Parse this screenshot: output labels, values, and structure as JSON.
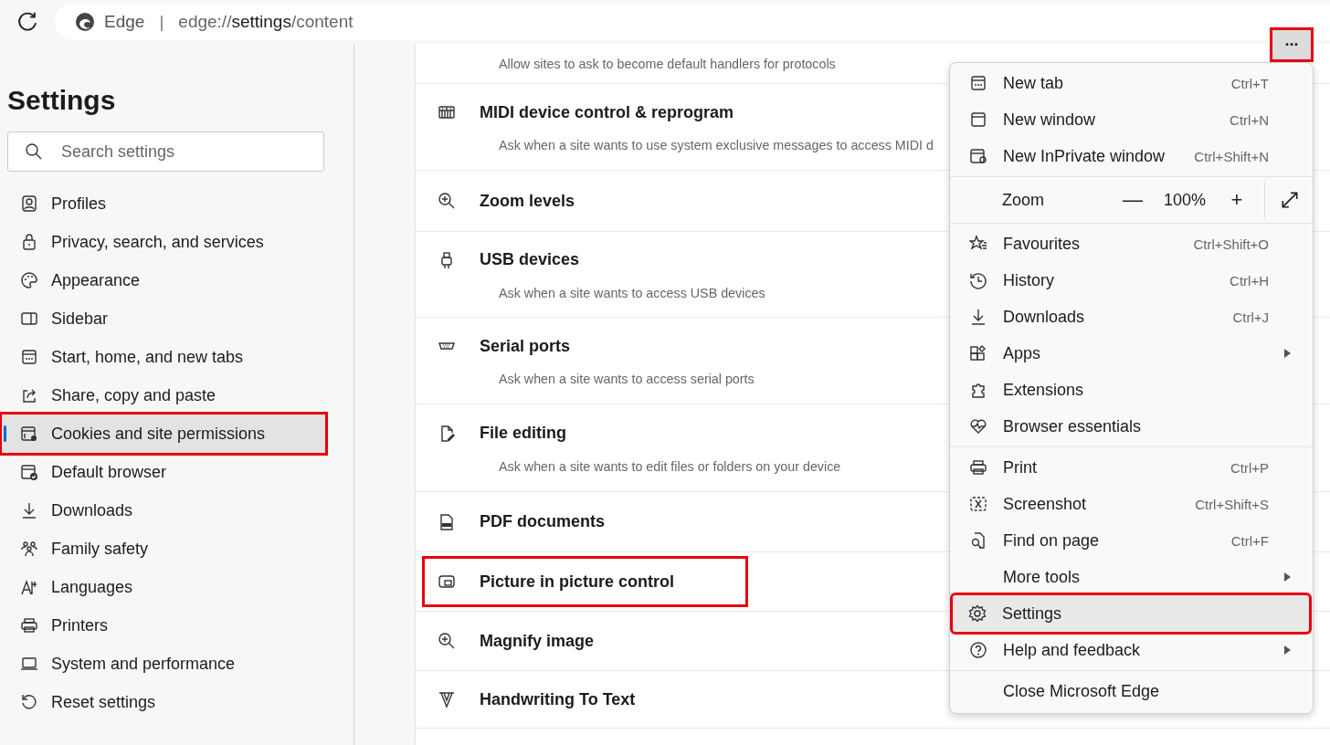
{
  "address_bar": {
    "browser_label": "Edge",
    "separator": "|",
    "url": "edge://**settings**/content"
  },
  "sidebar": {
    "title": "Settings",
    "search": {
      "placeholder": "Search settings"
    },
    "items": [
      {
        "label": "Profiles",
        "selected": false,
        "highlighted": false
      },
      {
        "label": "Privacy, search, and services",
        "selected": false,
        "highlighted": false
      },
      {
        "label": "Appearance",
        "selected": false,
        "highlighted": false
      },
      {
        "label": "Sidebar",
        "selected": false,
        "highlighted": false
      },
      {
        "label": "Start, home, and new tabs",
        "selected": false,
        "highlighted": false
      },
      {
        "label": "Share, copy and paste",
        "selected": false,
        "highlighted": false
      },
      {
        "label": "Cookies and site permissions",
        "selected": true,
        "highlighted": true
      },
      {
        "label": "Default browser",
        "selected": false,
        "highlighted": false
      },
      {
        "label": "Downloads",
        "selected": false,
        "highlighted": false
      },
      {
        "label": "Family safety",
        "selected": false,
        "highlighted": false
      },
      {
        "label": "Languages",
        "selected": false,
        "highlighted": false
      },
      {
        "label": "Printers",
        "selected": false,
        "highlighted": false
      },
      {
        "label": "System and performance",
        "selected": false,
        "highlighted": false
      },
      {
        "label": "Reset settings",
        "selected": false,
        "highlighted": false
      }
    ]
  },
  "permissions": [
    {
      "description": "Allow sites to ask to become default handlers for protocols",
      "highlighted": false
    },
    {
      "title": "MIDI device control & reprogram",
      "description": "Ask when a site wants to use system exclusive messages to access MIDI d",
      "highlighted": false
    },
    {
      "title": "Zoom levels",
      "highlighted": false
    },
    {
      "title": "USB devices",
      "description": "Ask when a site wants to access USB devices",
      "highlighted": false
    },
    {
      "title": "Serial ports",
      "description": "Ask when a site wants to access serial ports",
      "highlighted": false
    },
    {
      "title": "File editing",
      "description": "Ask when a site wants to edit files or folders on your device",
      "highlighted": false
    },
    {
      "title": "PDF documents",
      "highlighted": false
    },
    {
      "title": "Picture in picture control",
      "highlighted": true
    },
    {
      "title": "Magnify image",
      "highlighted": false
    },
    {
      "title": "Handwriting To Text",
      "highlighted": false
    }
  ],
  "more_button": {
    "label": "···",
    "highlighted": true
  },
  "menu": {
    "groups": [
      {
        "kind": "items",
        "items": [
          {
            "label": "New tab",
            "shortcut": "Ctrl+T",
            "submenu": false,
            "selected": false,
            "highlighted": false
          },
          {
            "label": "New window",
            "shortcut": "Ctrl+N",
            "submenu": false,
            "selected": false,
            "highlighted": false
          },
          {
            "label": "New InPrivate window",
            "shortcut": "Ctrl+Shift+N",
            "submenu": false,
            "selected": false,
            "highlighted": false
          }
        ]
      },
      {
        "kind": "zoom",
        "label": "Zoom",
        "minus": "—",
        "value": "100%",
        "plus": "+"
      },
      {
        "kind": "items",
        "items": [
          {
            "label": "Favourites",
            "shortcut": "Ctrl+Shift+O",
            "submenu": false,
            "selected": false,
            "highlighted": false
          },
          {
            "label": "History",
            "shortcut": "Ctrl+H",
            "submenu": false,
            "selected": false,
            "highlighted": false
          },
          {
            "label": "Downloads",
            "shortcut": "Ctrl+J",
            "submenu": false,
            "selected": false,
            "highlighted": false
          },
          {
            "label": "Apps",
            "submenu": true,
            "selected": false,
            "highlighted": false
          },
          {
            "label": "Extensions",
            "submenu": false,
            "selected": false,
            "highlighted": false
          },
          {
            "label": "Browser essentials",
            "submenu": false,
            "selected": false,
            "highlighted": false
          }
        ]
      },
      {
        "kind": "items",
        "items": [
          {
            "label": "Print",
            "shortcut": "Ctrl+P",
            "submenu": false,
            "selected": false,
            "highlighted": false
          },
          {
            "label": "Screenshot",
            "shortcut": "Ctrl+Shift+S",
            "submenu": false,
            "selected": false,
            "highlighted": false
          },
          {
            "label": "Find on page",
            "shortcut": "Ctrl+F",
            "submenu": false,
            "selected": false,
            "highlighted": false
          },
          {
            "label": "More tools",
            "submenu": true,
            "selected": false,
            "highlighted": false
          },
          {
            "label": "Settings",
            "submenu": false,
            "selected": true,
            "highlighted": true
          },
          {
            "label": "Help and feedback",
            "submenu": true,
            "selected": false,
            "highlighted": false
          }
        ]
      },
      {
        "kind": "items",
        "items": [
          {
            "label": "Close Microsoft Edge",
            "submenu": false,
            "selected": false,
            "highlighted": false
          }
        ]
      }
    ]
  }
}
